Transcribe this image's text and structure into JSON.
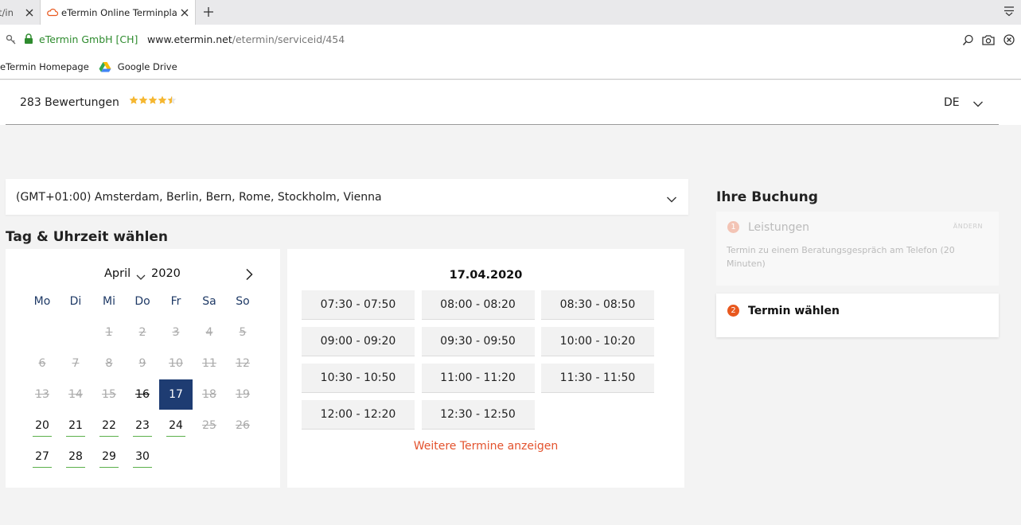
{
  "browser": {
    "prev_tab_title": "t/in",
    "active_tab_title": "eTermin Online Terminplaner",
    "site_identity": "eTermin GmbH [CH]",
    "url_domain": "www.etermin.net",
    "url_path": "/etermin/serviceid/454",
    "bookmarks": [
      {
        "label": "eTermin Homepage",
        "icon": "etermin-icon"
      },
      {
        "label": "Google Drive",
        "icon": "google-drive-icon"
      }
    ]
  },
  "header": {
    "reviews": "283 Bewertungen",
    "rating": 4.5,
    "rating_max": 5,
    "language": "DE"
  },
  "timezone": "(GMT+01:00) Amsterdam, Berlin, Bern, Rome, Stockholm, Vienna",
  "section_title": "Tag & Uhrzeit wählen",
  "calendar": {
    "month": "April",
    "year": "2020",
    "weekdays": [
      "Mo",
      "Di",
      "Mi",
      "Do",
      "Fr",
      "Sa",
      "So"
    ],
    "days": [
      {
        "d": "1",
        "s": "past"
      },
      {
        "d": "2",
        "s": "past"
      },
      {
        "d": "3",
        "s": "past"
      },
      {
        "d": "4",
        "s": "past"
      },
      {
        "d": "5",
        "s": "past"
      },
      {
        "d": "6",
        "s": "past"
      },
      {
        "d": "7",
        "s": "past"
      },
      {
        "d": "8",
        "s": "past"
      },
      {
        "d": "9",
        "s": "past"
      },
      {
        "d": "10",
        "s": "past"
      },
      {
        "d": "11",
        "s": "past"
      },
      {
        "d": "12",
        "s": "past"
      },
      {
        "d": "13",
        "s": "past"
      },
      {
        "d": "14",
        "s": "past"
      },
      {
        "d": "15",
        "s": "past"
      },
      {
        "d": "16",
        "s": "today"
      },
      {
        "d": "17",
        "s": "sel"
      },
      {
        "d": "18",
        "s": "past"
      },
      {
        "d": "19",
        "s": "past"
      },
      {
        "d": "20",
        "s": "avail"
      },
      {
        "d": "21",
        "s": "avail"
      },
      {
        "d": "22",
        "s": "avail"
      },
      {
        "d": "23",
        "s": "avail"
      },
      {
        "d": "24",
        "s": "avail"
      },
      {
        "d": "25",
        "s": "past"
      },
      {
        "d": "26",
        "s": "past"
      },
      {
        "d": "27",
        "s": "avail"
      },
      {
        "d": "28",
        "s": "avail"
      },
      {
        "d": "29",
        "s": "avail"
      },
      {
        "d": "30",
        "s": "avail"
      }
    ]
  },
  "slots": {
    "date": "17.04.2020",
    "times": [
      "07:30 - 07:50",
      "08:00 - 08:20",
      "08:30 - 08:50",
      "09:00 - 09:20",
      "09:30 - 09:50",
      "10:00 - 10:20",
      "10:30 - 10:50",
      "11:00 - 11:20",
      "11:30 - 11:50",
      "12:00 - 12:20",
      "12:30 - 12:50"
    ],
    "more_link": "Weitere Termine anzeigen"
  },
  "booking": {
    "title": "Ihre Buchung",
    "step1": {
      "num": "1",
      "label": "Leistungen",
      "change": "ÄNDERN",
      "desc": "Termin zu einem Beratungsgespräch am Telefon (20 Minuten)"
    },
    "step2": {
      "num": "2",
      "label": "Termin wählen"
    }
  },
  "colors": {
    "accent": "#e8581e",
    "selected_day": "#1e3c72",
    "available_underline": "#5bb04a",
    "star": "#f5b731",
    "link": "#e3522d"
  }
}
